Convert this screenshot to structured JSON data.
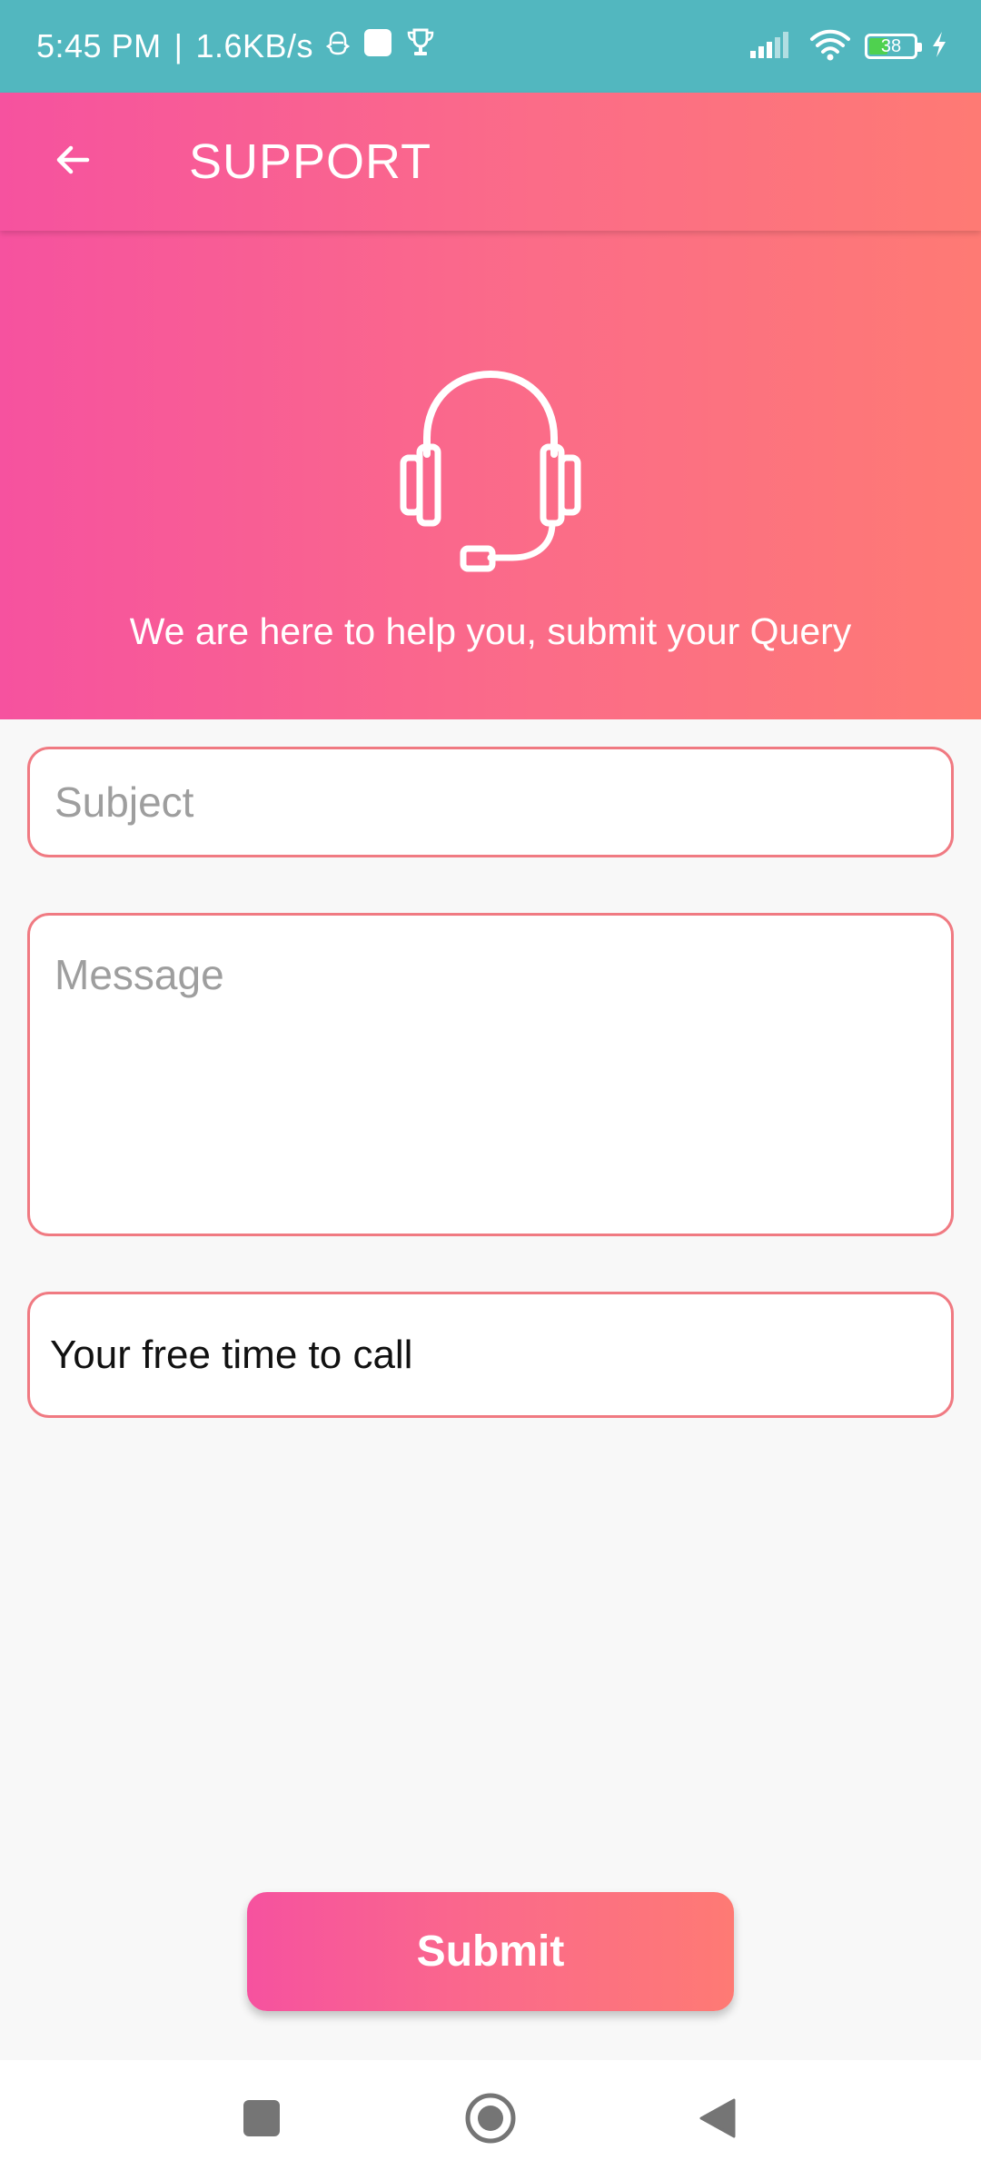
{
  "status_bar": {
    "time": "5:45 PM",
    "separator": "|",
    "net_speed": "1.6KB/s",
    "battery_level": "38",
    "icons": [
      "snapchat-ghost-icon",
      "app-square-icon",
      "trophy-icon",
      "signal-icon",
      "wifi-icon",
      "battery-icon",
      "charging-bolt-icon"
    ]
  },
  "app_bar": {
    "title": "SUPPORT",
    "back_icon": "arrow-left-icon"
  },
  "hero": {
    "icon": "headset-icon",
    "tagline": "We are here to help you, submit your Query"
  },
  "form": {
    "subject_placeholder": "Subject",
    "message_placeholder": "Message",
    "call_time_value": "Your free time to call"
  },
  "submit_label": "Submit",
  "colors": {
    "status_bar": "#52b7bf",
    "gradient_start": "#f6529f",
    "gradient_end": "#fe7a74",
    "field_border": "#f07a82",
    "background": "#f8f8f8"
  },
  "nav_bar": {
    "buttons": [
      "recents-square-icon",
      "home-circle-icon",
      "back-triangle-icon"
    ]
  }
}
